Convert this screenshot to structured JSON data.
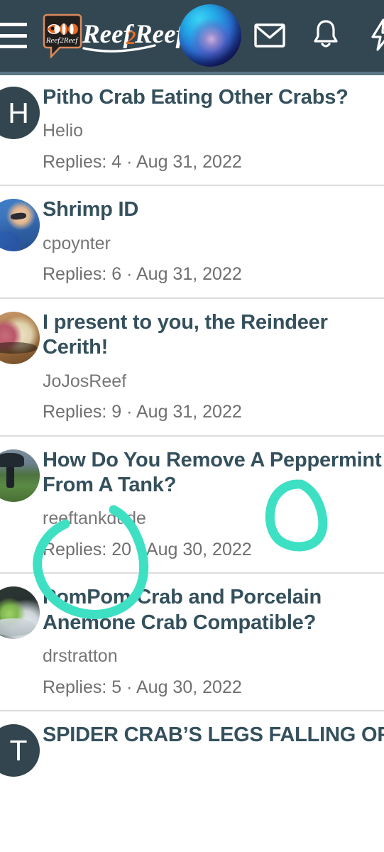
{
  "header": {
    "menu_label": "Menu",
    "logo_text": "Reef2Reef",
    "logo_badge_text": "Reef2Reef",
    "icons": {
      "hamburger": "hamburger-menu-icon",
      "logo": "reef2reef-logo-icon",
      "avatar": "user-avatar",
      "mail": "mail-icon",
      "bell": "bell-notification-icon",
      "bolt": "lightning-bolt-icon"
    },
    "background_color": "#334752",
    "underline_color": "#5a7584"
  },
  "colors": {
    "title": "#34505c",
    "meta": "#6f6f6f",
    "author": "#767676",
    "divider": "#dcdcdc",
    "page_background": "#ffffff",
    "annotation": "#3ee0c4"
  },
  "threads": [
    {
      "title": "Pitho Crab Eating Other Crabs?",
      "author": "Helio",
      "meta": "Replies: 4 · Aug 31, 2022",
      "replies": 4,
      "date": "Aug 31, 2022",
      "avatar_type": "letter",
      "avatar_letter": "H"
    },
    {
      "title": "Shrimp ID",
      "author": "cpoynter",
      "meta": "Replies: 6 · Aug 31, 2022",
      "replies": 6,
      "date": "Aug 31, 2022",
      "avatar_type": "photo-person",
      "avatar_letter": ""
    },
    {
      "title": "I present to you, the Reindeer Cerith!",
      "author": "JoJosReef",
      "meta": "Replies: 9 · Aug 31, 2022",
      "replies": 9,
      "date": "Aug 31, 2022",
      "avatar_type": "photo-cerith",
      "avatar_letter": ""
    },
    {
      "title": "How Do You Remove A Peppermint Shrimp From A Tank?",
      "author": "reeftankdude",
      "meta": "Replies: 20 · Aug 30, 2022",
      "replies": 20,
      "date": "Aug 30, 2022",
      "avatar_type": "photo-field",
      "avatar_letter": ""
    },
    {
      "title": "PomPom Crab and Porcelain Anemone Crab Compatible?",
      "author": "drstratton",
      "meta": "Replies: 5 · Aug 30, 2022",
      "replies": 5,
      "date": "Aug 30, 2022",
      "avatar_type": "photo-pom",
      "avatar_letter": ""
    },
    {
      "title": "SPIDER CRAB’S LEGS FALLING OFF",
      "author": "",
      "meta": "",
      "replies": null,
      "date": "",
      "avatar_type": "letter",
      "avatar_letter": "T"
    }
  ],
  "annotations": {
    "color": "#3ee0c4",
    "marks": [
      {
        "name": "circle-around-shrimp-from-a-tank",
        "shape": "open-oval",
        "target": "Shrimp From A Tank / reeftankdude"
      },
      {
        "name": "circle-around-a-peppermint",
        "shape": "oval",
        "target": "A Pepperm"
      }
    ]
  }
}
